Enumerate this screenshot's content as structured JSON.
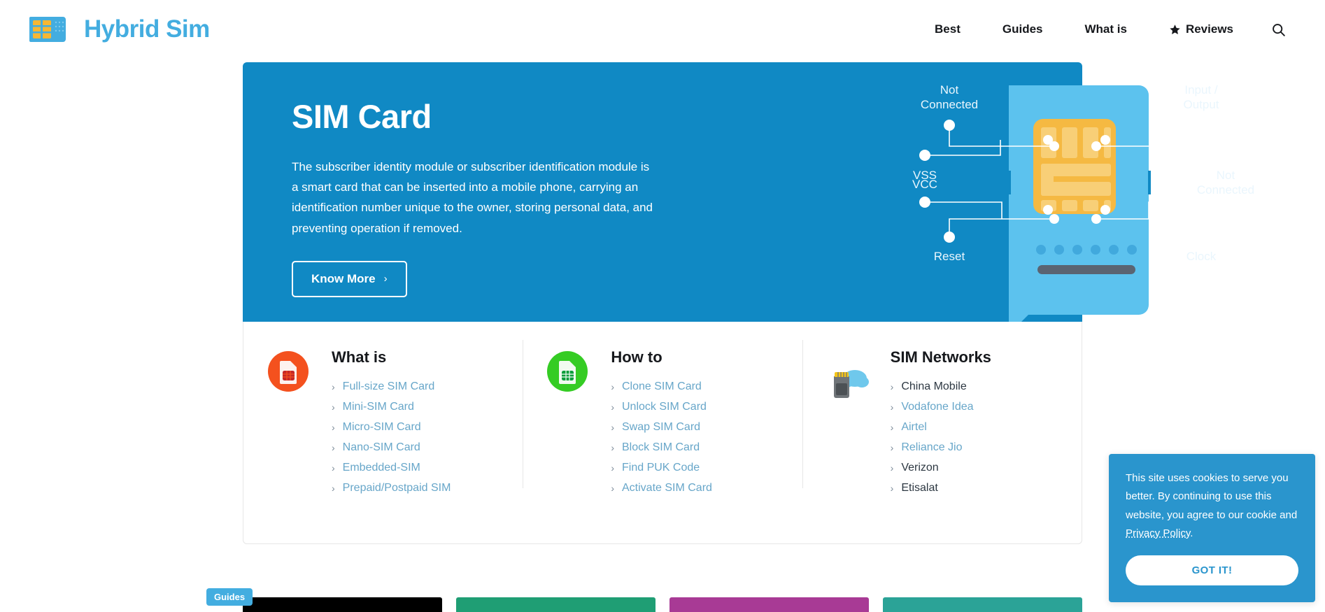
{
  "header": {
    "brand_name": "Hybrid Sim",
    "logo_icon": "sim-card-icon",
    "nav": [
      {
        "label": "Best",
        "icon": null
      },
      {
        "label": "Guides",
        "icon": null
      },
      {
        "label": "What is",
        "icon": null
      },
      {
        "label": "Reviews",
        "icon": "star-icon"
      }
    ],
    "search_icon": "search-icon"
  },
  "hero": {
    "title": "SIM Card",
    "description": "The subscriber identity module or subscriber identification module is a smart card that can be inserted into a mobile phone, carrying an identification number unique to the owner, storing personal data, and preventing operation if removed.",
    "cta_label": "Know More",
    "cta_chevron": "›",
    "background_color": "#1089c4",
    "illustration": {
      "name": "sim-card-pinout-diagram",
      "labels_left": [
        "Not Connected",
        "VSS",
        "VCC",
        "Reset"
      ],
      "labels_right": [
        "Input / Output",
        "Not Connected",
        "Clock"
      ]
    }
  },
  "columns": [
    {
      "title": "What is",
      "icon": "sim-card-orange-icon",
      "icon_color": "#f4511e",
      "links": [
        {
          "label": "Full-size SIM Card",
          "style": "link"
        },
        {
          "label": "Mini-SIM Card",
          "style": "link"
        },
        {
          "label": "Micro-SIM Card",
          "style": "link"
        },
        {
          "label": "Nano-SIM Card",
          "style": "link"
        },
        {
          "label": "Embedded-SIM",
          "style": "link"
        },
        {
          "label": "Prepaid/Postpaid SIM",
          "style": "link"
        }
      ]
    },
    {
      "title": "How to",
      "icon": "sim-card-green-icon",
      "icon_color": "#35cc24",
      "links": [
        {
          "label": "Clone SIM Card",
          "style": "link"
        },
        {
          "label": "Unlock SIM Card",
          "style": "link"
        },
        {
          "label": "Swap SIM Card",
          "style": "link"
        },
        {
          "label": "Block SIM Card",
          "style": "link"
        },
        {
          "label": "Find PUK Code",
          "style": "link"
        },
        {
          "label": "Activate SIM Card",
          "style": "link"
        }
      ]
    },
    {
      "title": "SIM Networks",
      "icon": "cloud-sim-icon",
      "icon_color": "#6f7478",
      "links": [
        {
          "label": "China Mobile",
          "style": "plain"
        },
        {
          "label": "Vodafone Idea",
          "style": "link"
        },
        {
          "label": "Airtel",
          "style": "link"
        },
        {
          "label": "Reliance Jio",
          "style": "link"
        },
        {
          "label": "Verizon",
          "style": "plain"
        },
        {
          "label": "Etisalat",
          "style": "plain"
        }
      ]
    }
  ],
  "bottom_cards": {
    "badge_label": "Guides",
    "cards": [
      {
        "color": "#000000"
      },
      {
        "color": "#1f9e74"
      },
      {
        "color": "#a83a95"
      },
      {
        "color": "#2ba397"
      }
    ]
  },
  "cookie_banner": {
    "text_before": "This site uses cookies to serve you better. By continuing to use this website, you agree to our cookie and ",
    "link_label": "Privacy Policy",
    "text_after": ".",
    "button_label": "GOT IT!",
    "background_color": "#2a95cd"
  },
  "chevron": "›"
}
